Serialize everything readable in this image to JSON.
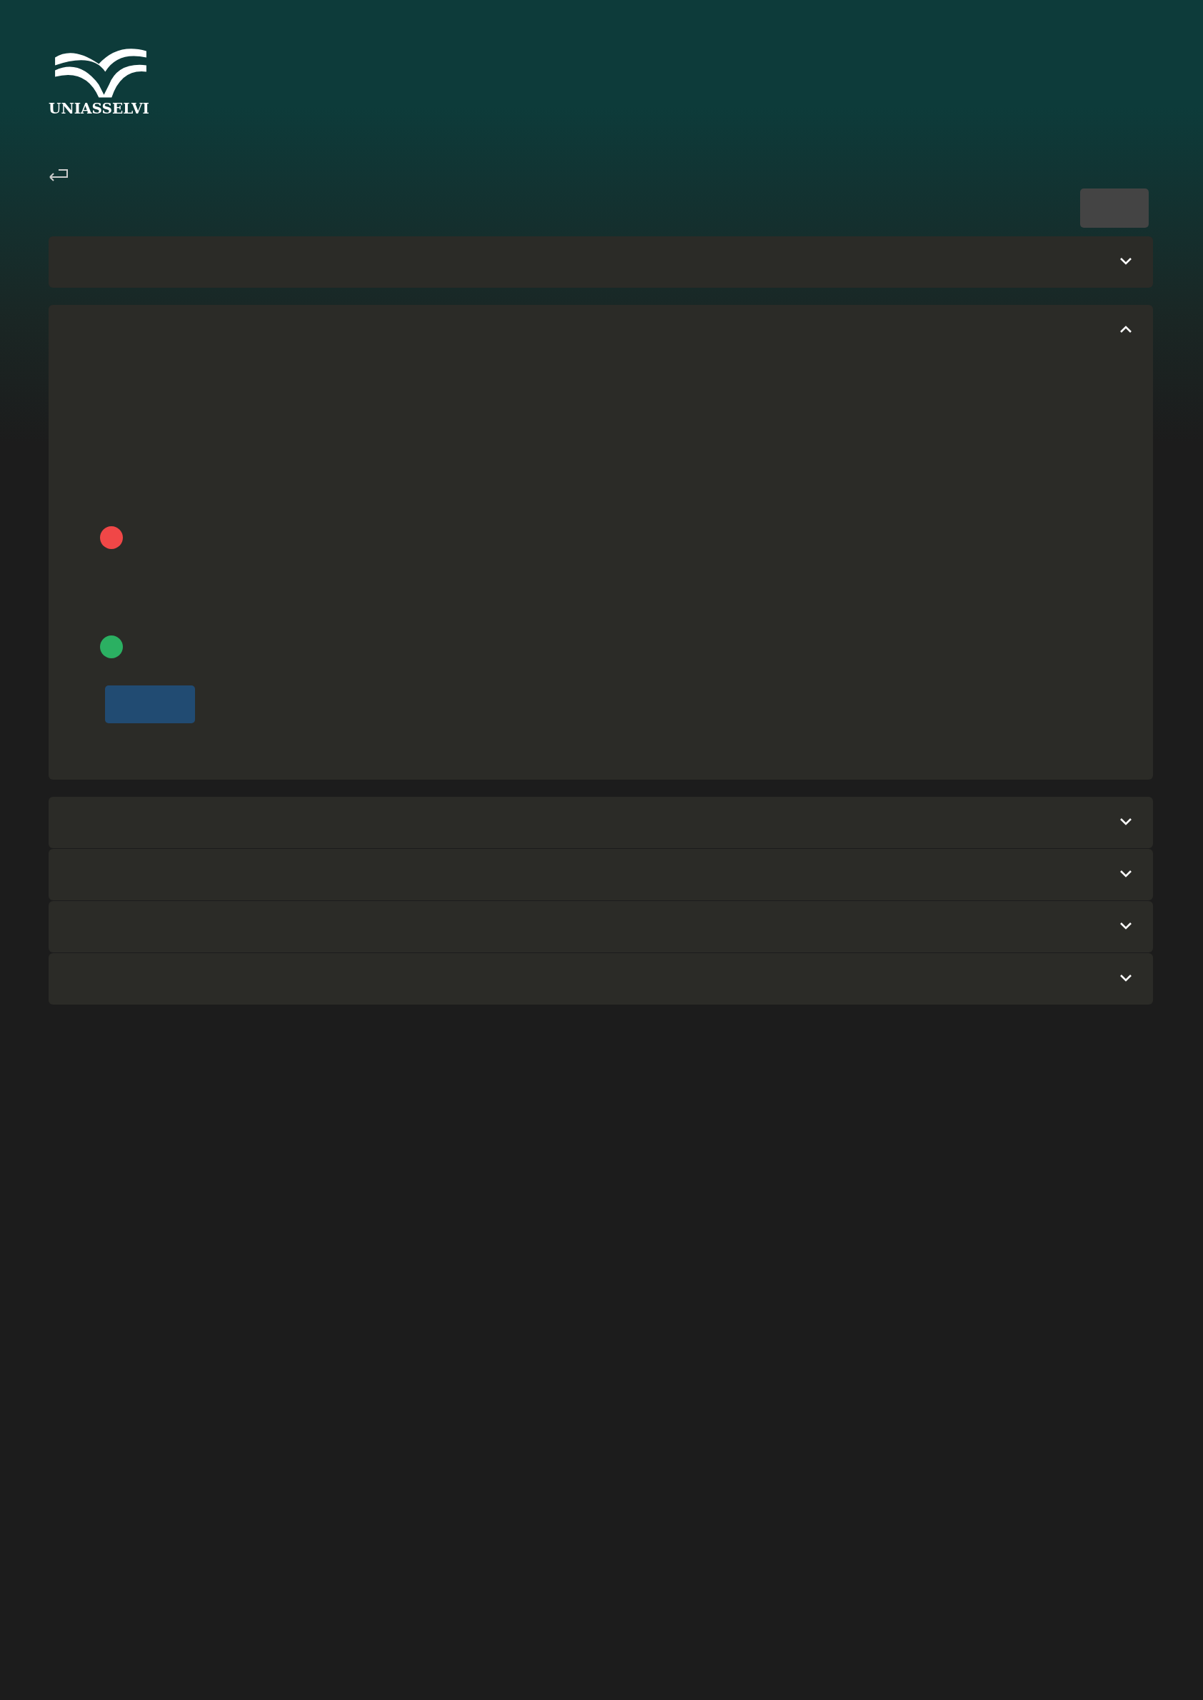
{
  "logo": {
    "text": "UNIASSELVI"
  },
  "sections": [
    {
      "expanded": false
    },
    {
      "expanded": true,
      "options": [
        {
          "color": "#f04747"
        },
        {
          "color": "#2bb062"
        }
      ]
    },
    {
      "expanded": false
    },
    {
      "expanded": false
    },
    {
      "expanded": false
    },
    {
      "expanded": false
    }
  ]
}
